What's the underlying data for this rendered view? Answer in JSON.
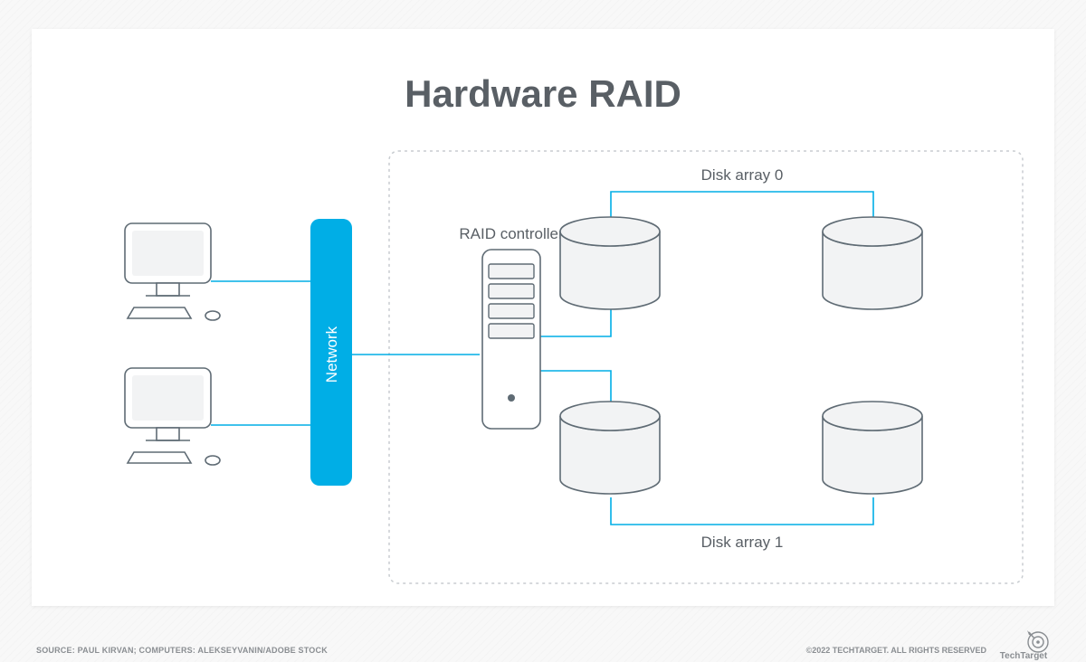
{
  "title": "Hardware RAID",
  "labels": {
    "network": "Network",
    "raid_controller": "RAID controller",
    "disk_array_0": "Disk array 0",
    "disk_array_1": "Disk array 1"
  },
  "footer": {
    "source": "SOURCE: PAUL KIRVAN; COMPUTERS: ALEKSEYVANIN/ADOBE STOCK",
    "copyright": "©2022 TECHTARGET. ALL RIGHTS RESERVED",
    "logo_text": "TechTarget"
  },
  "colors": {
    "accent": "#00aee6",
    "stroke": "#5f6b74",
    "fill_light": "#f2f3f4",
    "title": "#595f65",
    "gray": "#8a8e92"
  }
}
